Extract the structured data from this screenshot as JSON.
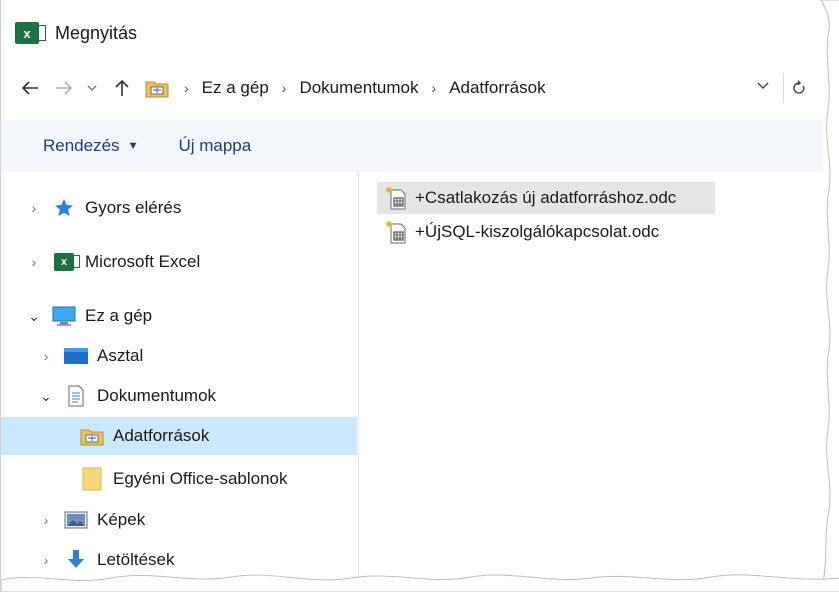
{
  "window": {
    "title": "Megnyitás",
    "app_icon": "excel-icon",
    "accent": "#1d7044"
  },
  "nav": {
    "back_icon": "arrow-left-icon",
    "forward_icon": "arrow-right-icon",
    "recent_icon": "chevron-down-icon",
    "up_icon": "arrow-up-icon",
    "refresh_icon": "refresh-icon",
    "breadcrumbs": [
      "Ez a gép",
      "Dokumentumok",
      "Adatforrások"
    ]
  },
  "toolbar": {
    "organize_label": "Rendezés",
    "new_folder_label": "Új mappa",
    "text_color": "#1b3f7a",
    "background": "#f3f6fb"
  },
  "tree": {
    "selected_color": "#cce8ff",
    "items": [
      {
        "label": "Gyors elérés",
        "icon": "star-icon",
        "expanded": false
      },
      {
        "label": "Microsoft Excel",
        "icon": "excel-icon",
        "expanded": false
      },
      {
        "label": "Ez a gép",
        "icon": "computer-icon",
        "expanded": true
      },
      {
        "label": "Asztal",
        "icon": "desktop-icon",
        "expanded": false
      },
      {
        "label": "Dokumentumok",
        "icon": "documents-icon",
        "expanded": true
      },
      {
        "label": "Adatforrások",
        "icon": "datasource-folder-icon",
        "selected": true
      },
      {
        "label": "Egyéni Office-sablonok",
        "icon": "folder-icon"
      },
      {
        "label": "Képek",
        "icon": "pictures-icon",
        "expanded": false
      },
      {
        "label": "Letöltések",
        "icon": "download-icon",
        "expanded": false
      }
    ]
  },
  "files": [
    {
      "name": "+Csatlakozás új adatforráshoz.odc",
      "icon": "odc-file-icon",
      "hovered": true
    },
    {
      "name": "+ÚjSQL-kiszolgálókapcsolat.odc",
      "icon": "odc-file-icon",
      "hovered": false
    }
  ]
}
